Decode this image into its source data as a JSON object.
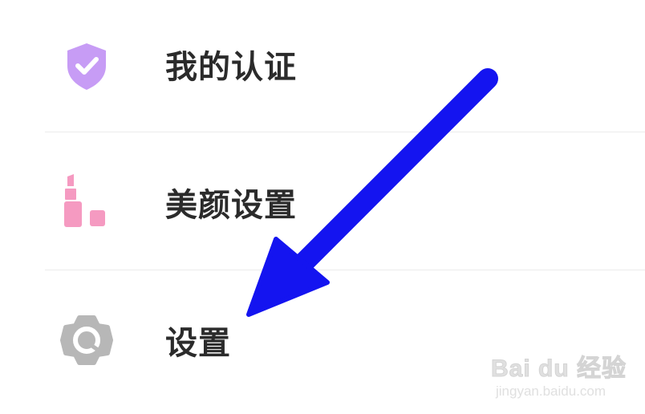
{
  "menu": {
    "items": [
      {
        "label": "我的认证",
        "icon": "verified-shield-icon",
        "icon_color": "#c79cf5"
      },
      {
        "label": "美颜设置",
        "icon": "lipstick-icon",
        "icon_color": "#f59ac1"
      },
      {
        "label": "设置",
        "icon": "gear-icon",
        "icon_color": "#b7b7b7"
      }
    ]
  },
  "annotation": {
    "arrow_color": "#1414f0"
  },
  "watermark": {
    "brand": "Bai du 经验",
    "site": "jingyan.baidu.com"
  }
}
